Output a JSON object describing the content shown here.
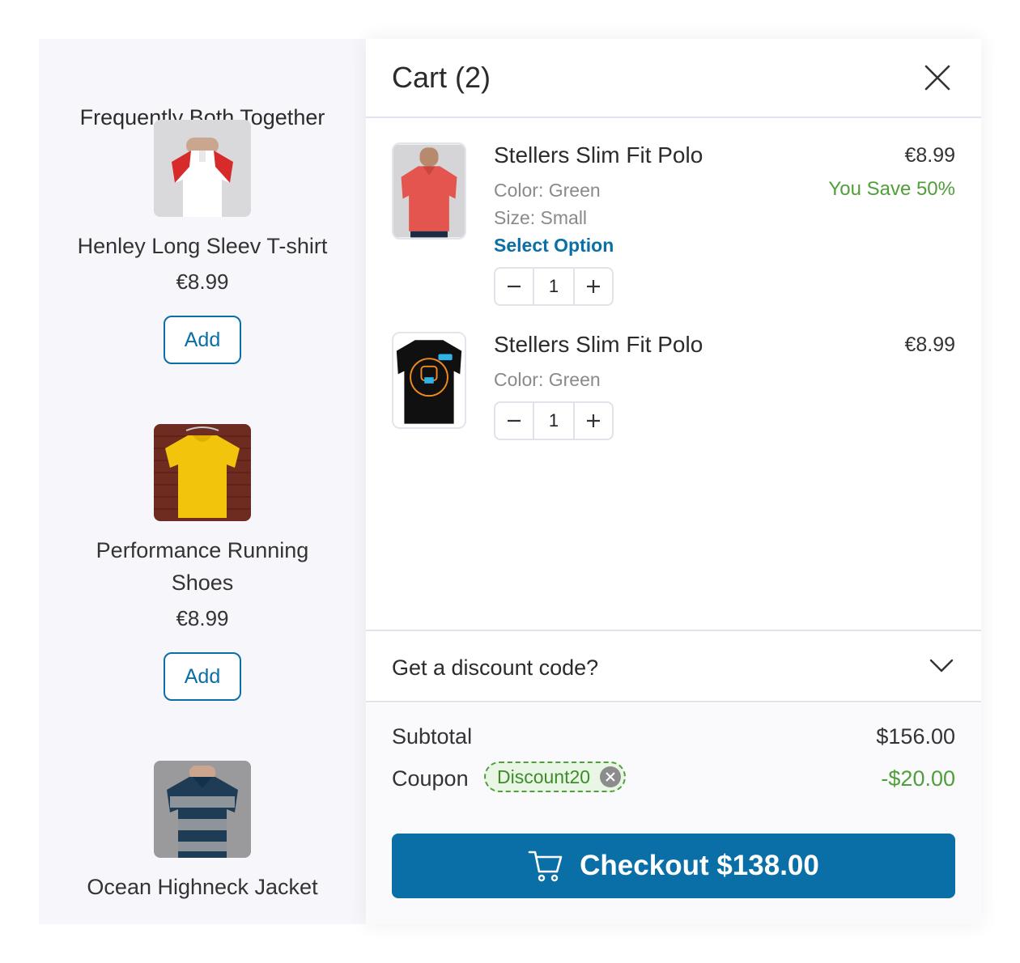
{
  "recommendations": {
    "title": "Frequently Both Together",
    "items": [
      {
        "name": "Henley Long Sleev T-shirt",
        "price": "€8.99",
        "add_label": "Add"
      },
      {
        "name": "Performance Running Shoes",
        "price": "€8.99",
        "add_label": "Add"
      },
      {
        "name": "Ocean Highneck Jacket"
      }
    ]
  },
  "cart": {
    "title": "Cart (2)",
    "items": [
      {
        "name": "Stellers Slim Fit Polo",
        "color": "Color: Green",
        "size": "Size: Small",
        "option_label": "Select Option",
        "quantity": "1",
        "price": "€8.99",
        "savings": "You Save 50%"
      },
      {
        "name": "Stellers Slim Fit Polo",
        "color": "Color: Green",
        "quantity": "1",
        "price": "€8.99"
      }
    ],
    "discount_prompt": "Get a discount code?",
    "summary": {
      "subtotal_label": "Subtotal",
      "subtotal_value": "$156.00",
      "coupon_label": "Coupon",
      "coupon_code": "Discount20",
      "coupon_value": "-$20.00"
    },
    "checkout_label": "Checkout $138.00"
  },
  "colors": {
    "accent": "#0a6fa6",
    "success": "#4f9f3a",
    "panel_bg": "#f7f7fb"
  }
}
